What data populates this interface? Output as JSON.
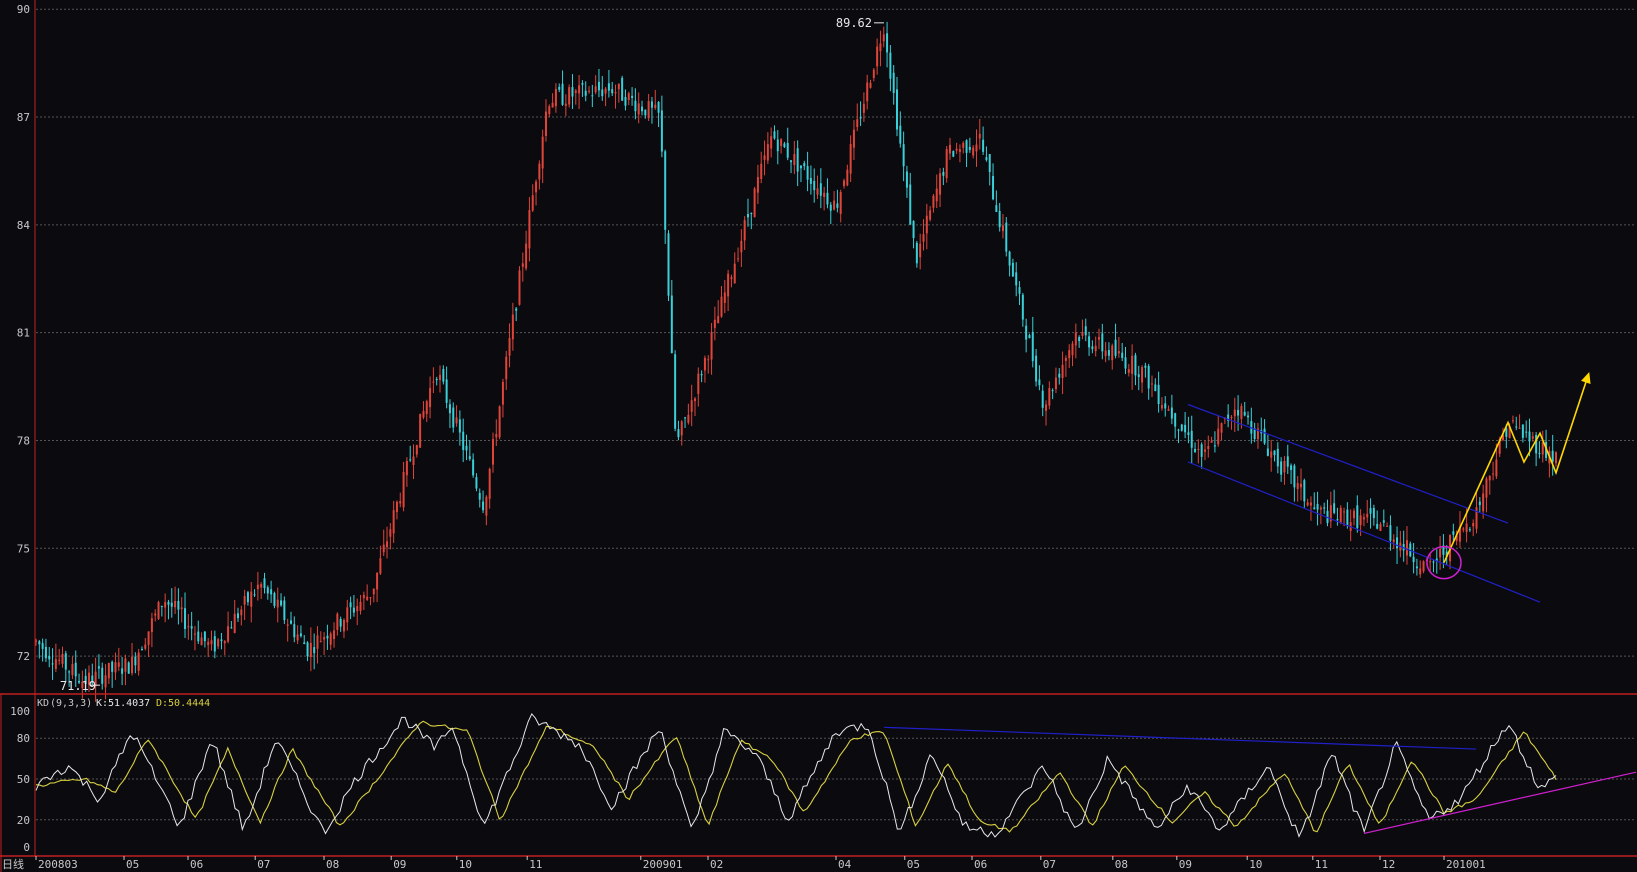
{
  "colors": {
    "background": "#0b0a0f",
    "up_candle": "#e0453a",
    "down_candle": "#39d0d8",
    "frame": "#c02020",
    "grid": "#555555",
    "channel": "#2020c8",
    "forecast": "#ffd700",
    "highlight": "#d020d0",
    "k_line": "#e8e8e8",
    "d_line": "#d8d040",
    "support_line": "#d020d0"
  },
  "chart_data": [
    {
      "type": "candlestick",
      "title": "",
      "ylim": [
        71,
        90.2
      ],
      "y_ticks": [
        "90",
        "87",
        "84",
        "81",
        "78",
        "75",
        "72"
      ],
      "x_labels": [
        "200803",
        "05",
        "06",
        "07",
        "08",
        "09",
        "10",
        "11",
        "200901",
        "02",
        "04",
        "05",
        "06",
        "07",
        "08",
        "09",
        "10",
        "11",
        "12",
        "201001"
      ],
      "trend_keypoints": [
        {
          "x": 0,
          "y": 72.4
        },
        {
          "x": 0.03,
          "y": 71.3
        },
        {
          "x": 0.06,
          "y": 71.8
        },
        {
          "x": 0.08,
          "y": 73.6
        },
        {
          "x": 0.11,
          "y": 72.2
        },
        {
          "x": 0.14,
          "y": 74.0
        },
        {
          "x": 0.17,
          "y": 72.2
        },
        {
          "x": 0.21,
          "y": 73.8
        },
        {
          "x": 0.25,
          "y": 80.0
        },
        {
          "x": 0.28,
          "y": 76.2
        },
        {
          "x": 0.32,
          "y": 87.5
        },
        {
          "x": 0.36,
          "y": 87.8
        },
        {
          "x": 0.39,
          "y": 87.0
        },
        {
          "x": 0.4,
          "y": 77.8
        },
        {
          "x": 0.42,
          "y": 80.5
        },
        {
          "x": 0.46,
          "y": 86.5
        },
        {
          "x": 0.5,
          "y": 84.5
        },
        {
          "x": 0.53,
          "y": 89.6
        },
        {
          "x": 0.55,
          "y": 83.0
        },
        {
          "x": 0.57,
          "y": 86.0
        },
        {
          "x": 0.59,
          "y": 86.4
        },
        {
          "x": 0.63,
          "y": 79.0
        },
        {
          "x": 0.65,
          "y": 81.0
        },
        {
          "x": 0.69,
          "y": 80.0
        },
        {
          "x": 0.73,
          "y": 77.5
        },
        {
          "x": 0.75,
          "y": 79.0
        },
        {
          "x": 0.8,
          "y": 76.0
        },
        {
          "x": 0.84,
          "y": 75.7
        },
        {
          "x": 0.87,
          "y": 74.4
        },
        {
          "x": 0.9,
          "y": 76.0
        },
        {
          "x": 0.92,
          "y": 78.5
        },
        {
          "x": 0.95,
          "y": 77.5
        }
      ],
      "annotations": [
        {
          "text": "89.62",
          "x": 0.53,
          "y": 89.62
        },
        {
          "text": "71.19",
          "x": 0.04,
          "y": 71.19
        }
      ],
      "channel": {
        "upper": [
          [
            0.72,
            79.0
          ],
          [
            0.92,
            75.7
          ]
        ],
        "lower": [
          [
            0.72,
            77.4
          ],
          [
            0.94,
            73.5
          ]
        ]
      },
      "forecast_path": [
        [
          0.88,
          74.6
        ],
        [
          0.92,
          78.5
        ],
        [
          0.93,
          77.4
        ],
        [
          0.94,
          78.2
        ],
        [
          0.95,
          77.1
        ],
        [
          0.97,
          79.8
        ]
      ],
      "highlight_ellipse": {
        "x": 0.88,
        "y": 74.6
      }
    },
    {
      "type": "line",
      "indicator": "KD",
      "header": {
        "name": "KD",
        "params": "(9,3,3)",
        "k_label": "K:51.4037",
        "d_label": "D:50.4444"
      },
      "ylim": [
        0,
        100
      ],
      "y_ticks": [
        "100",
        "80",
        "50",
        "20",
        "0"
      ],
      "series": [
        {
          "name": "K"
        },
        {
          "name": "D"
        }
      ],
      "k_keypoints": [
        {
          "x": 0.0,
          "y": 45
        },
        {
          "x": 0.02,
          "y": 60
        },
        {
          "x": 0.04,
          "y": 35
        },
        {
          "x": 0.06,
          "y": 85
        },
        {
          "x": 0.09,
          "y": 15
        },
        {
          "x": 0.11,
          "y": 80
        },
        {
          "x": 0.13,
          "y": 12
        },
        {
          "x": 0.15,
          "y": 80
        },
        {
          "x": 0.18,
          "y": 10
        },
        {
          "x": 0.2,
          "y": 50
        },
        {
          "x": 0.23,
          "y": 95
        },
        {
          "x": 0.25,
          "y": 72
        },
        {
          "x": 0.26,
          "y": 90
        },
        {
          "x": 0.28,
          "y": 15
        },
        {
          "x": 0.31,
          "y": 95
        },
        {
          "x": 0.34,
          "y": 75
        },
        {
          "x": 0.36,
          "y": 30
        },
        {
          "x": 0.39,
          "y": 88
        },
        {
          "x": 0.41,
          "y": 10
        },
        {
          "x": 0.43,
          "y": 85
        },
        {
          "x": 0.45,
          "y": 68
        },
        {
          "x": 0.47,
          "y": 20
        },
        {
          "x": 0.5,
          "y": 85
        },
        {
          "x": 0.52,
          "y": 90
        },
        {
          "x": 0.54,
          "y": 10
        },
        {
          "x": 0.56,
          "y": 70
        },
        {
          "x": 0.58,
          "y": 15
        },
        {
          "x": 0.6,
          "y": 10
        },
        {
          "x": 0.63,
          "y": 60
        },
        {
          "x": 0.65,
          "y": 10
        },
        {
          "x": 0.67,
          "y": 65
        },
        {
          "x": 0.7,
          "y": 12
        },
        {
          "x": 0.72,
          "y": 45
        },
        {
          "x": 0.74,
          "y": 12
        },
        {
          "x": 0.77,
          "y": 60
        },
        {
          "x": 0.79,
          "y": 5
        },
        {
          "x": 0.81,
          "y": 70
        },
        {
          "x": 0.83,
          "y": 10
        },
        {
          "x": 0.85,
          "y": 75
        },
        {
          "x": 0.87,
          "y": 20
        },
        {
          "x": 0.89,
          "y": 35
        },
        {
          "x": 0.92,
          "y": 92
        },
        {
          "x": 0.94,
          "y": 42
        },
        {
          "x": 0.95,
          "y": 51
        }
      ],
      "d_keypoints": [
        {
          "x": 0.0,
          "y": 45
        },
        {
          "x": 0.03,
          "y": 50
        },
        {
          "x": 0.05,
          "y": 40
        },
        {
          "x": 0.07,
          "y": 80
        },
        {
          "x": 0.1,
          "y": 20
        },
        {
          "x": 0.12,
          "y": 72
        },
        {
          "x": 0.14,
          "y": 18
        },
        {
          "x": 0.16,
          "y": 72
        },
        {
          "x": 0.19,
          "y": 15
        },
        {
          "x": 0.21,
          "y": 45
        },
        {
          "x": 0.24,
          "y": 92
        },
        {
          "x": 0.27,
          "y": 85
        },
        {
          "x": 0.29,
          "y": 20
        },
        {
          "x": 0.32,
          "y": 90
        },
        {
          "x": 0.35,
          "y": 72
        },
        {
          "x": 0.37,
          "y": 35
        },
        {
          "x": 0.4,
          "y": 82
        },
        {
          "x": 0.42,
          "y": 15
        },
        {
          "x": 0.44,
          "y": 78
        },
        {
          "x": 0.46,
          "y": 65
        },
        {
          "x": 0.48,
          "y": 25
        },
        {
          "x": 0.51,
          "y": 80
        },
        {
          "x": 0.53,
          "y": 85
        },
        {
          "x": 0.55,
          "y": 15
        },
        {
          "x": 0.57,
          "y": 62
        },
        {
          "x": 0.59,
          "y": 18
        },
        {
          "x": 0.61,
          "y": 12
        },
        {
          "x": 0.64,
          "y": 55
        },
        {
          "x": 0.66,
          "y": 15
        },
        {
          "x": 0.68,
          "y": 60
        },
        {
          "x": 0.71,
          "y": 18
        },
        {
          "x": 0.73,
          "y": 40
        },
        {
          "x": 0.75,
          "y": 15
        },
        {
          "x": 0.78,
          "y": 55
        },
        {
          "x": 0.8,
          "y": 10
        },
        {
          "x": 0.82,
          "y": 62
        },
        {
          "x": 0.84,
          "y": 15
        },
        {
          "x": 0.86,
          "y": 65
        },
        {
          "x": 0.88,
          "y": 25
        },
        {
          "x": 0.9,
          "y": 35
        },
        {
          "x": 0.93,
          "y": 85
        },
        {
          "x": 0.95,
          "y": 50
        }
      ],
      "resistance_line": [
        [
          0.53,
          88
        ],
        [
          0.9,
          72
        ]
      ],
      "support_line": [
        [
          0.83,
          10
        ],
        [
          1.0,
          55
        ]
      ]
    }
  ]
}
